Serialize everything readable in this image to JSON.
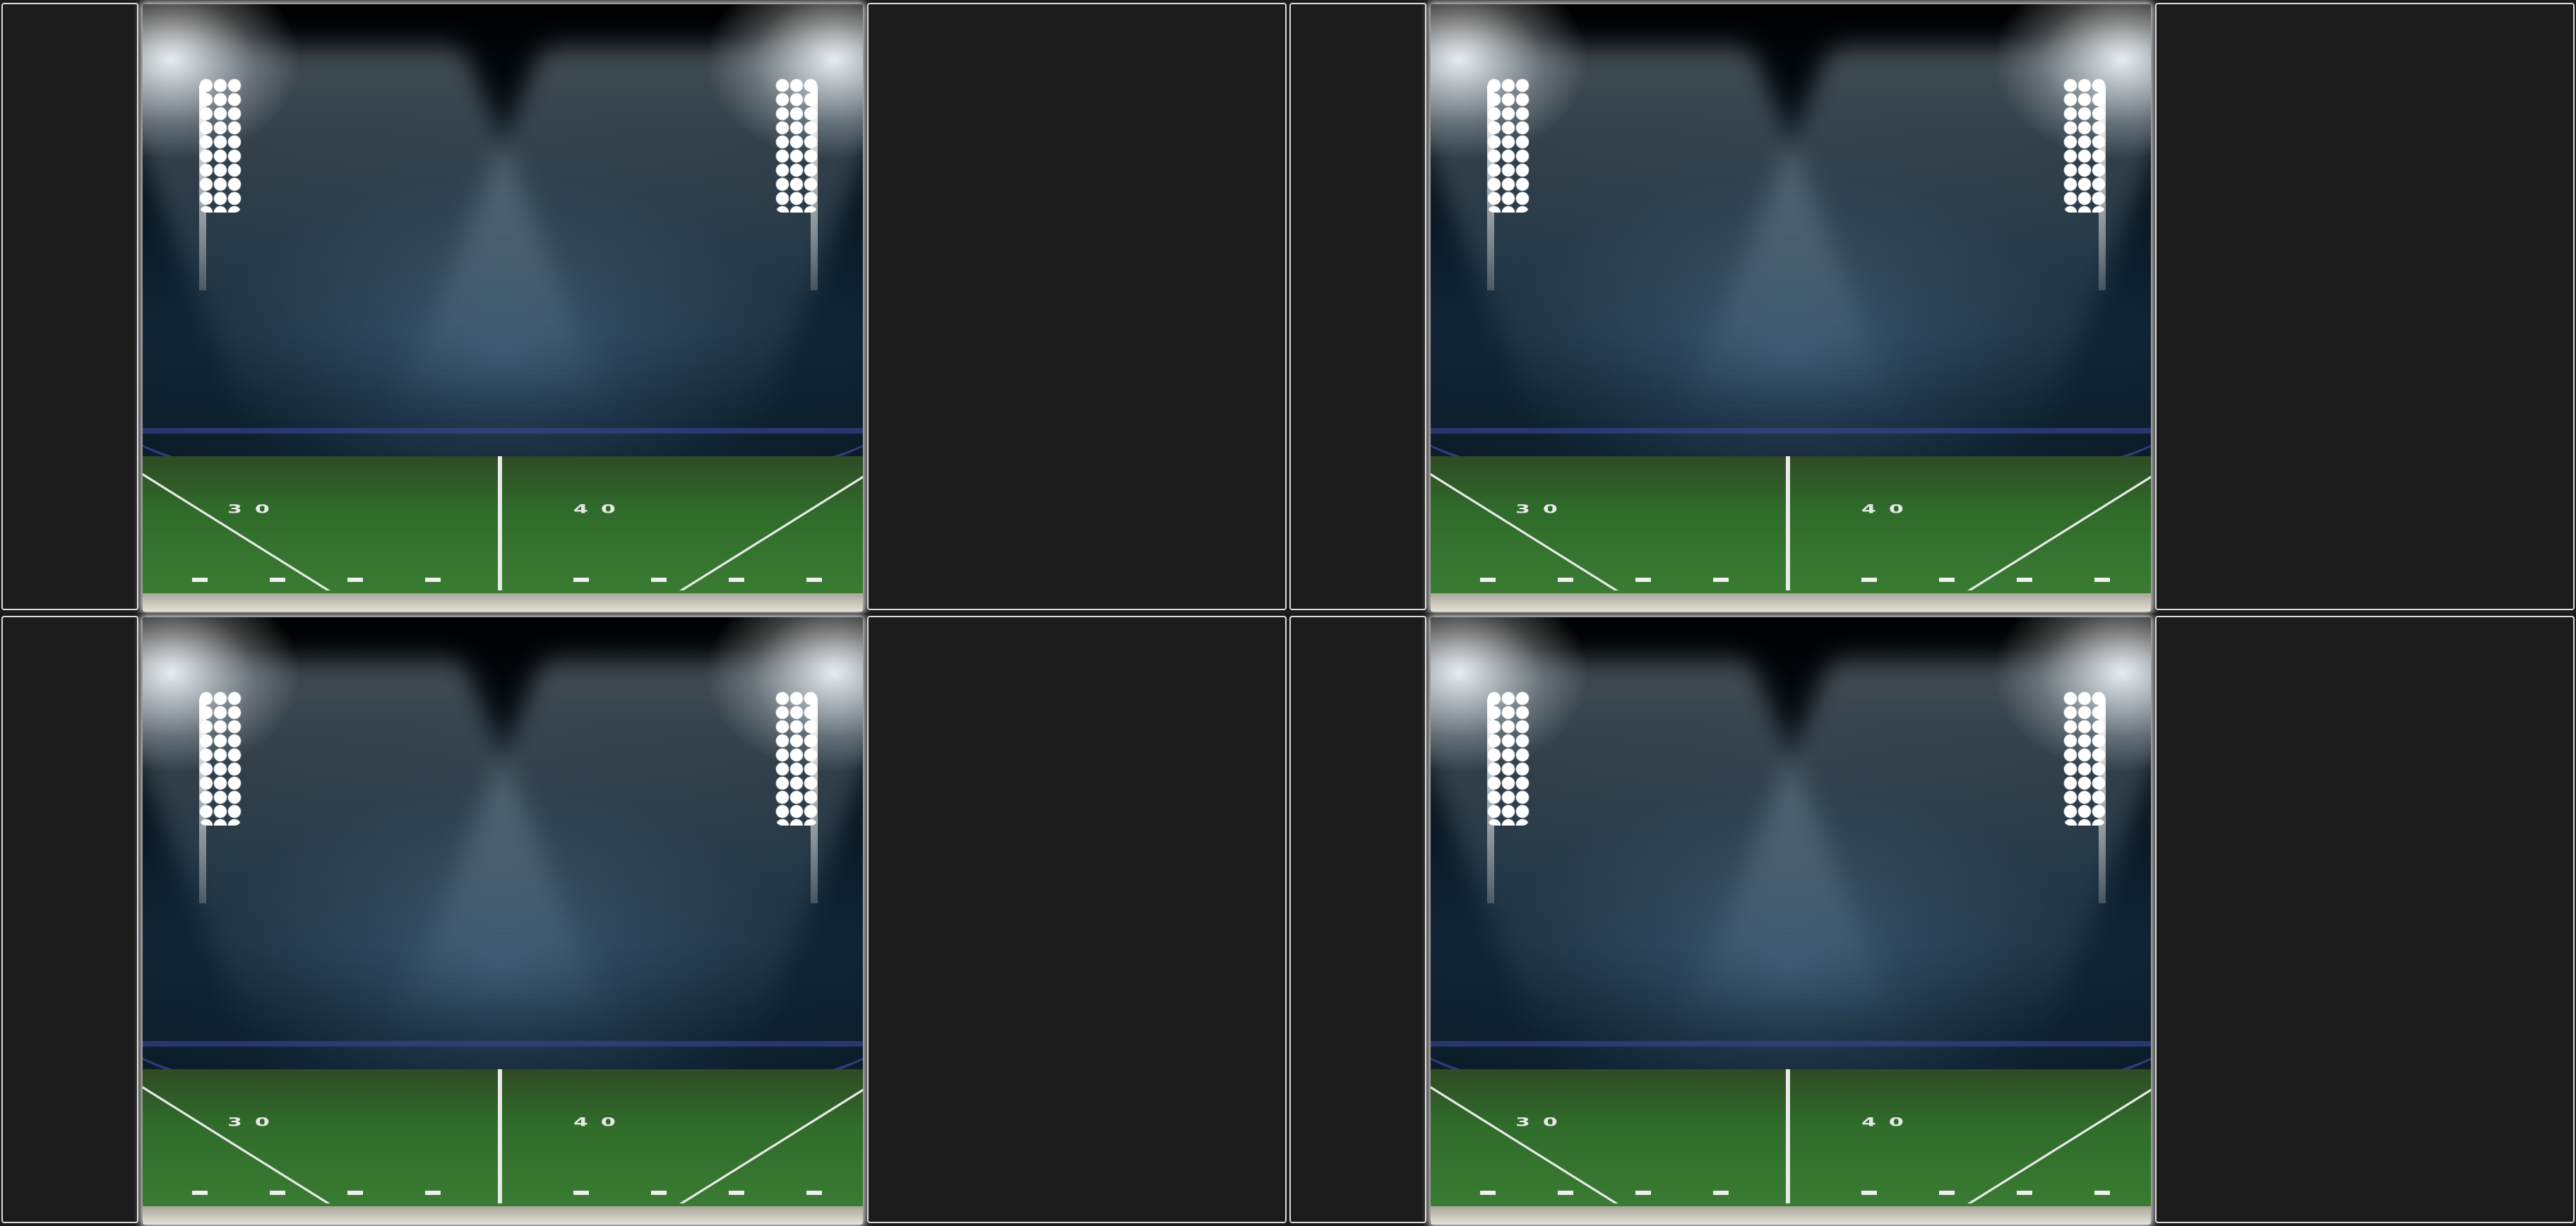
{
  "tiles": [
    {
      "yard_left": "30",
      "yard_right": "40"
    },
    {
      "yard_left": "30",
      "yard_right": "40"
    },
    {
      "yard_left": "30",
      "yard_right": "40"
    },
    {
      "yard_left": "30",
      "yard_right": "40"
    }
  ],
  "colors": {
    "background": "#1b1b1b",
    "divider": "#d6d6d6",
    "field": "#2f6b2a",
    "rail": "#3c4696"
  },
  "icons": []
}
